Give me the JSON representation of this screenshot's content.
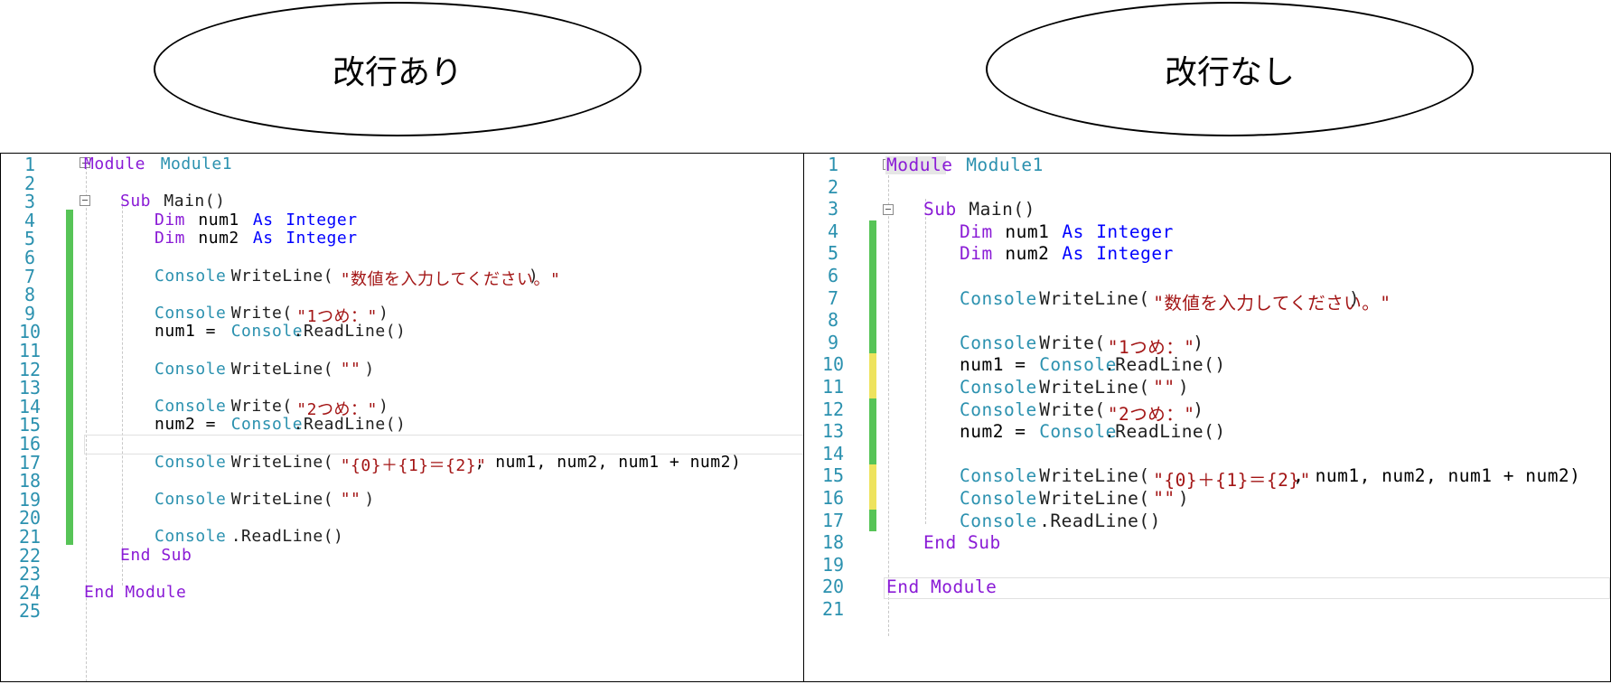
{
  "labels": {
    "left": "改行あり",
    "right": "改行なし"
  },
  "colors": {
    "keyword": "#0000ff",
    "type_keyword": "#8a1bd6",
    "class": "#2b91af",
    "string": "#a31515",
    "line_number": "#2b91af",
    "change_saved": "#57c457",
    "change_unsaved": "#eee35e"
  },
  "left_editor": {
    "line_numbers": [
      "1",
      "2",
      "3",
      "4",
      "5",
      "6",
      "7",
      "8",
      "9",
      "10",
      "11",
      "12",
      "13",
      "14",
      "15",
      "16",
      "17",
      "18",
      "19",
      "20",
      "21",
      "22",
      "23",
      "24",
      "25"
    ],
    "lines": {
      "l1_kw": "Module",
      "l1_name": "Module1",
      "l3_kw": "Sub",
      "l3_rest": "Main()",
      "l4_dim": "Dim",
      "l4_var": "num1",
      "l4_as": "As",
      "l4_type": "Integer",
      "l5_dim": "Dim",
      "l5_var": "num2",
      "l5_as": "As",
      "l5_type": "Integer",
      "l7_cls": "Console",
      "l7_m": "WriteLine(",
      "l7_str": "\"数値を入力してください。\"",
      "l7_end": ")",
      "l9_cls": "Console",
      "l9_m": "Write(",
      "l9_str": "\"1つめ：\"",
      "l9_end": ")",
      "l10_var": "num1 = ",
      "l10_cls": "Console",
      "l10_m": ".ReadLine()",
      "l12_cls": "Console",
      "l12_m": "WriteLine(",
      "l12_str": "\"\"",
      "l12_end": ")",
      "l14_cls": "Console",
      "l14_m": "Write(",
      "l14_str": "\"2つめ：\"",
      "l14_end": ")",
      "l15_var": "num2 = ",
      "l15_cls": "Console",
      "l15_m": ".ReadLine()",
      "l17_cls": "Console",
      "l17_m": "WriteLine(",
      "l17_str": "\"{0}＋{1}＝{2}\"",
      "l17_end": ", num1, num2, num1 + num2)",
      "l19_cls": "Console",
      "l19_m": "WriteLine(",
      "l19_str": "\"\"",
      "l19_end": ")",
      "l21_cls": "Console",
      "l21_m": ".ReadLine()",
      "l22_kw": "End Sub",
      "l24_kw": "End Module"
    }
  },
  "right_editor": {
    "line_numbers": [
      "1",
      "2",
      "3",
      "4",
      "5",
      "6",
      "7",
      "8",
      "9",
      "10",
      "11",
      "12",
      "13",
      "14",
      "15",
      "16",
      "17",
      "18",
      "19",
      "20",
      "21"
    ],
    "lines": {
      "l1_kw": "Module",
      "l1_name": "Module1",
      "l3_kw": "Sub",
      "l3_rest": "Main()",
      "l4_dim": "Dim",
      "l4_var": "num1",
      "l4_as": "As",
      "l4_type": "Integer",
      "l5_dim": "Dim",
      "l5_var": "num2",
      "l5_as": "As",
      "l5_type": "Integer",
      "l7_cls": "Console",
      "l7_m": "WriteLine(",
      "l7_str": "\"数値を入力してください。\"",
      "l7_end": ")",
      "l9_cls": "Console",
      "l9_m": "Write(",
      "l9_str": "\"1つめ：\"",
      "l9_end": ")",
      "l10_var": "num1 = ",
      "l10_cls": "Console",
      "l10_m": ".ReadLine()",
      "l11_cls": "Console",
      "l11_m": "WriteLine(",
      "l11_str": "\"\"",
      "l11_end": ")",
      "l12_cls": "Console",
      "l12_m": "Write(",
      "l12_str": "\"2つめ：\"",
      "l12_end": ")",
      "l13_var": "num2 = ",
      "l13_cls": "Console",
      "l13_m": ".ReadLine()",
      "l15_cls": "Console",
      "l15_m": "WriteLine(",
      "l15_str": "\"{0}＋{1}＝{2}\"",
      "l15_end": ", num1, num2, num1 + num2)",
      "l16_cls": "Console",
      "l16_m": "WriteLine(",
      "l16_str": "\"\"",
      "l16_end": ")",
      "l17_cls": "Console",
      "l17_m": ".ReadLine()",
      "l18_kw": "End Sub",
      "l20_kw": "End Module"
    }
  }
}
